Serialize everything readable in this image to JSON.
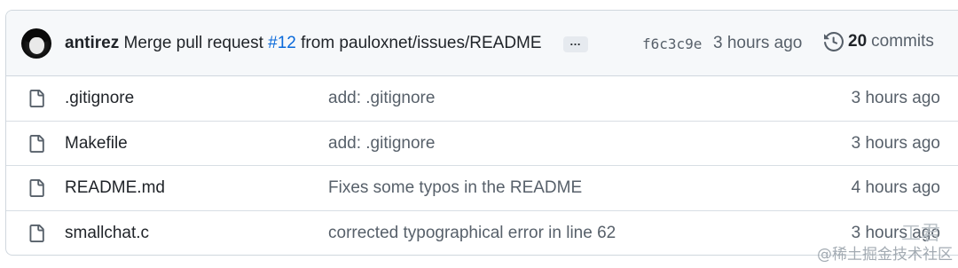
{
  "commit_header": {
    "author": "antirez",
    "message_prefix": " Merge pull request ",
    "pr_link": "#12",
    "message_suffix": " from pauloxnet/issues/README",
    "ellipsis": "…",
    "sha": "f6c3c9e",
    "time": "3 hours ago",
    "commit_count": "20",
    "commits_label": "commits"
  },
  "files": [
    {
      "name": ".gitignore",
      "message": "add: .gitignore",
      "time": "3 hours ago"
    },
    {
      "name": "Makefile",
      "message": "add: .gitignore",
      "time": "3 hours ago"
    },
    {
      "name": "README.md",
      "message": "Fixes some typos in the README",
      "time": "4 hours ago"
    },
    {
      "name": "smallchat.c",
      "message": "corrected typographical error in line 62",
      "time": "3 hours ago"
    }
  ],
  "watermark": {
    "top": "工君",
    "bottom": "@稀土掘金技术社区"
  },
  "colors": {
    "link": "#0969da",
    "muted": "#57606a",
    "border": "#d0d7de",
    "header_bg": "#f6f8fa"
  },
  "icons": {
    "file": "file-icon",
    "history": "history-icon",
    "avatar": "avatar"
  }
}
